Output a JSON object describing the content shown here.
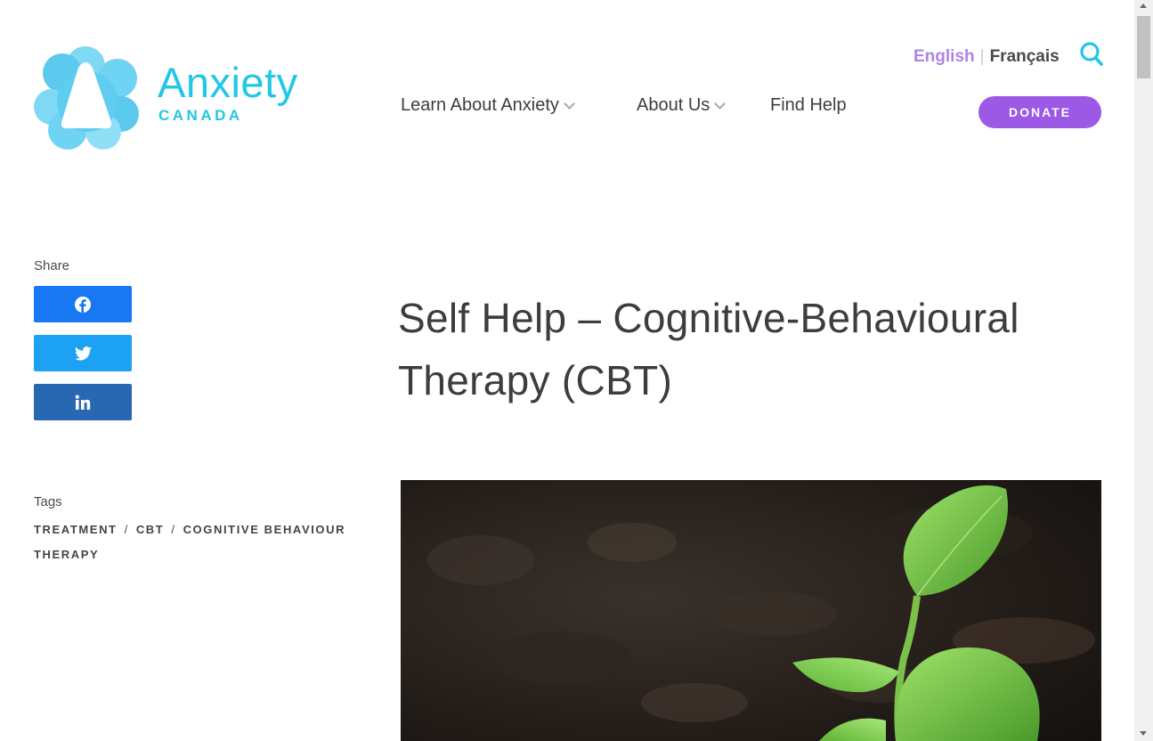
{
  "logo": {
    "word": "Anxiety",
    "sub": "CANADA"
  },
  "language": {
    "current": "English",
    "separator": "|",
    "alternate": "Français"
  },
  "nav": {
    "items": [
      {
        "label": "Learn About Anxiety",
        "has_dropdown": true
      },
      {
        "label": "About Us",
        "has_dropdown": true
      },
      {
        "label": "Find Help",
        "has_dropdown": false
      }
    ],
    "donate_label": "DONATE"
  },
  "share": {
    "label": "Share",
    "buttons": [
      {
        "network": "facebook",
        "icon": "facebook-icon",
        "color": "#1877f2"
      },
      {
        "network": "twitter",
        "icon": "twitter-icon",
        "color": "#1da1f2"
      },
      {
        "network": "linkedin",
        "icon": "linkedin-icon",
        "color": "#2867b2"
      }
    ]
  },
  "tags": {
    "label": "Tags",
    "items": [
      "TREATMENT",
      "CBT",
      "COGNITIVE BEHAVIOUR THERAPY"
    ],
    "separator": "/"
  },
  "article": {
    "title": "Self Help – Cognitive-Behavioural Therapy (CBT)",
    "hero_image": "seedling-sprout-in-soil"
  },
  "colors": {
    "brand_cyan": "#22c7e6",
    "accent_purple": "#9b59e6",
    "lang_active": "#b083e8"
  }
}
